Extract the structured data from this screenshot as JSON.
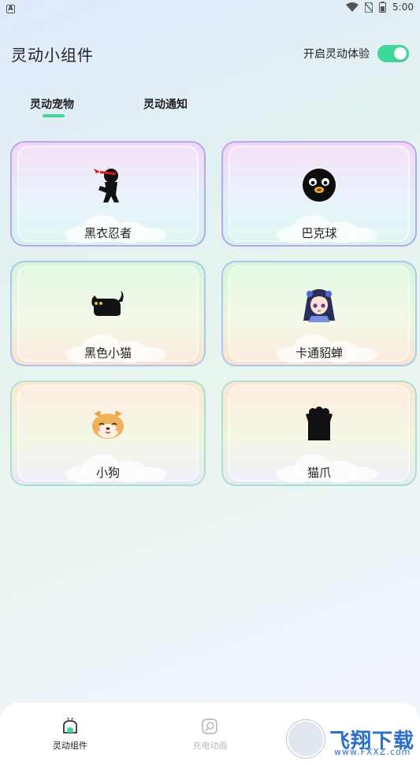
{
  "status_bar": {
    "app_badge": "A",
    "time": "5:00",
    "icons": [
      "wifi-icon",
      "no-sim-icon",
      "battery-icon"
    ]
  },
  "header": {
    "title": "灵动小组件",
    "toggle_label": "开启灵动体验",
    "toggle_on": true
  },
  "tabs": [
    {
      "label": "灵动宠物",
      "active": true
    },
    {
      "label": "灵动通知",
      "active": false
    }
  ],
  "cards": [
    {
      "label": "黑衣忍者",
      "icon": "ninja-icon"
    },
    {
      "label": "巴克球",
      "icon": "bucky-ball-icon"
    },
    {
      "label": "黑色小猫",
      "icon": "black-cat-icon"
    },
    {
      "label": "卡通貂蝉",
      "icon": "cartoon-diaochan-icon"
    },
    {
      "label": "小狗",
      "icon": "dog-icon"
    },
    {
      "label": "猫爪",
      "icon": "cat-paw-icon"
    }
  ],
  "bottom_nav": [
    {
      "label": "灵动组件",
      "icon": "widget-icon",
      "active": true
    },
    {
      "label": "充电动画",
      "icon": "charging-icon",
      "active": false
    }
  ],
  "watermark": {
    "text": "飞翔下载",
    "sub": "www.FXXZ.com"
  },
  "colors": {
    "accent": "#3fd79a",
    "watermark": "#2a6fd0"
  }
}
